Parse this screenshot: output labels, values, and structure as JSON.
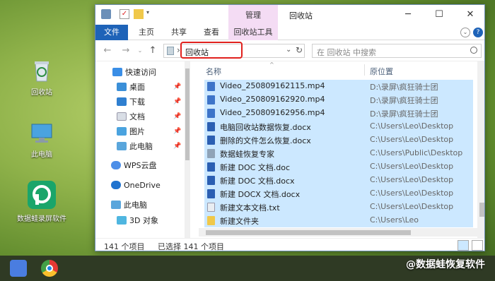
{
  "desktop": {
    "icons": [
      {
        "label": "回收站"
      },
      {
        "label": "此电脑"
      },
      {
        "label": "数据蛙录屏软件"
      }
    ]
  },
  "watermark": "@数据蛙恢复软件",
  "window": {
    "title": "回收站",
    "context_tab": "管理",
    "ribbon_tabs": [
      "文件",
      "主页",
      "共享",
      "查看",
      "回收站工具"
    ],
    "address": {
      "path": "回收站",
      "separator": "›"
    },
    "search_placeholder": "在 回收站 中搜索",
    "nav_pane": {
      "items": [
        {
          "label": "快速访问",
          "icon": "star-icon"
        },
        {
          "label": "桌面",
          "icon": "desktop-icon",
          "pinned": true
        },
        {
          "label": "下载",
          "icon": "download-icon",
          "pinned": true
        },
        {
          "label": "文档",
          "icon": "documents-icon",
          "pinned": true
        },
        {
          "label": "图片",
          "icon": "pictures-icon",
          "pinned": true
        },
        {
          "label": "此电脑",
          "icon": "computer-icon",
          "pinned": true
        },
        {
          "label": "WPS云盘",
          "icon": "cloud-icon"
        },
        {
          "label": "OneDrive",
          "icon": "onedrive-icon"
        },
        {
          "label": "此电脑",
          "icon": "computer-icon"
        },
        {
          "label": "3D 对象",
          "icon": "3d-icon"
        }
      ]
    },
    "columns": {
      "name": "名称",
      "location": "原位置"
    },
    "files": [
      {
        "name": "Video_250809162115.mp4",
        "location": "D:\\录屏\\疯狂骑士团",
        "type": "video"
      },
      {
        "name": "Video_250809162920.mp4",
        "location": "D:\\录屏\\疯狂骑士团",
        "type": "video"
      },
      {
        "name": "Video_250809162956.mp4",
        "location": "D:\\录屏\\疯狂骑士团",
        "type": "video"
      },
      {
        "name": "电脑回收站数据恢复.docx",
        "location": "C:\\Users\\Leo\\Desktop",
        "type": "word"
      },
      {
        "name": "删除的文件怎么恢复.docx",
        "location": "C:\\Users\\Leo\\Desktop",
        "type": "word"
      },
      {
        "name": "数据蛙恢复专家",
        "location": "C:\\Users\\Public\\Desktop",
        "type": "shortcut"
      },
      {
        "name": "新建 DOC 文档.doc",
        "location": "C:\\Users\\Leo\\Desktop",
        "type": "word"
      },
      {
        "name": "新建 DOC 文档.docx",
        "location": "C:\\Users\\Leo\\Desktop",
        "type": "word"
      },
      {
        "name": "新建 DOCX 文档.docx",
        "location": "C:\\Users\\Leo\\Desktop",
        "type": "word"
      },
      {
        "name": "新建文本文档.txt",
        "location": "C:\\Users\\Leo\\Desktop",
        "type": "text"
      },
      {
        "name": "新建文件夹",
        "location": "C:\\Users\\Leo",
        "type": "folder"
      }
    ],
    "status": {
      "count": "141 个项目",
      "selected": "已选择 141 个项目"
    }
  },
  "colors": {
    "selection": "#cce8ff",
    "file_tab": "#1e63b8",
    "context_tab": "#f4dcf4",
    "highlight_border": "#e0211d"
  }
}
